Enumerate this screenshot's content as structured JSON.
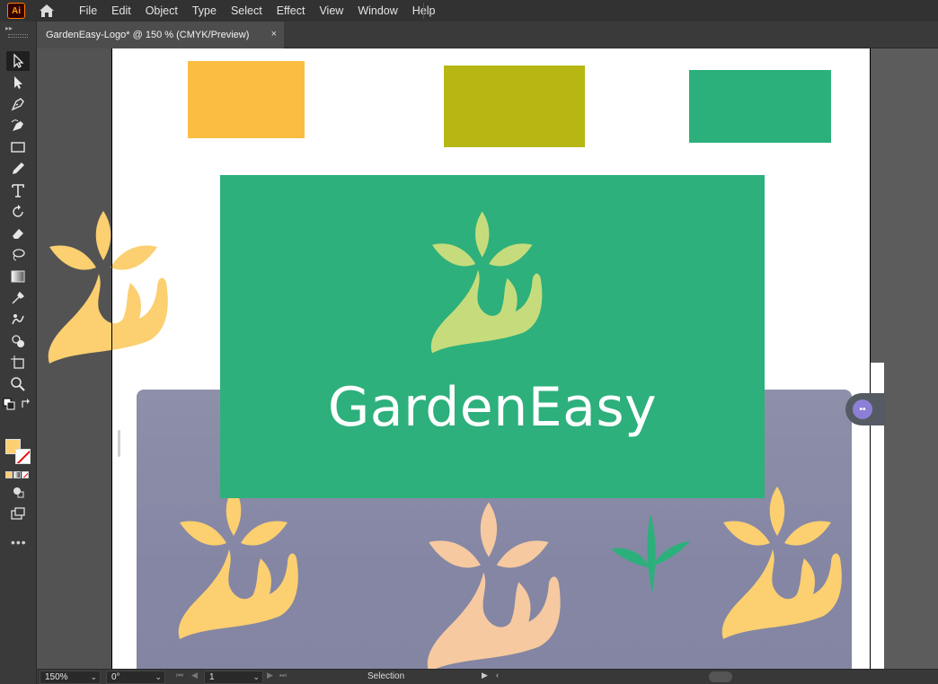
{
  "app": {
    "logo_text": "Ai"
  },
  "menu": [
    "File",
    "Edit",
    "Object",
    "Type",
    "Select",
    "Effect",
    "View",
    "Window",
    "Help"
  ],
  "document_tab": {
    "title": "GardenEasy-Logo* @ 150 % (CMYK/Preview)",
    "close": "×"
  },
  "artwork": {
    "brand_text": "GardenEasy",
    "colors": {
      "orange": "#fbbd42",
      "olive": "#b7b714",
      "green": "#2cb07b",
      "light_green": "#c6dc7c",
      "peach": "#fccf70",
      "skin": "#f6c9a0"
    }
  },
  "toolbar": {
    "tools": [
      "selection-tool",
      "direct-selection-tool",
      "pen-tool",
      "curvature-tool",
      "rectangle-tool",
      "pencil-tool",
      "type-tool",
      "rotate-tool",
      "eraser-tool",
      "lasso-tool",
      "gradient-tool",
      "eyedropper-tool",
      "puppet-warp-tool",
      "shape-builder-tool",
      "artboard-tool",
      "zoom-tool"
    ],
    "more": "•••"
  },
  "statusbar": {
    "zoom": "150%",
    "rotation": "0°",
    "artboard_number": "1",
    "tool_name": "Selection"
  }
}
